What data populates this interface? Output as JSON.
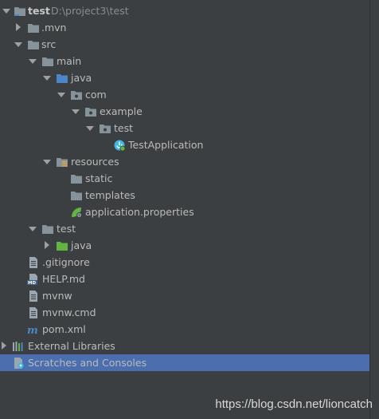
{
  "tree": {
    "rows": [
      {
        "name": "project-root-test",
        "label": "test",
        "path": "D:\\project3\\test",
        "arrow": "down",
        "icon": "project-folder-icon",
        "bold": true
      },
      {
        "name": "folder-mvn",
        "label": ".mvn",
        "arrow": "right",
        "icon": "folder-icon"
      },
      {
        "name": "folder-src",
        "label": "src",
        "arrow": "down",
        "icon": "folder-icon"
      },
      {
        "name": "folder-main",
        "label": "main",
        "arrow": "down",
        "icon": "folder-icon"
      },
      {
        "name": "folder-java",
        "label": "java",
        "arrow": "down",
        "icon": "source-root-icon"
      },
      {
        "name": "package-com",
        "label": "com",
        "arrow": "down",
        "icon": "package-icon"
      },
      {
        "name": "package-example",
        "label": "example",
        "arrow": "down",
        "icon": "package-icon"
      },
      {
        "name": "package-test",
        "label": "test",
        "arrow": "down",
        "icon": "package-icon"
      },
      {
        "name": "file-testapplication",
        "label": "TestApplication",
        "arrow": "",
        "icon": "spring-boot-class-icon"
      },
      {
        "name": "folder-resources",
        "label": "resources",
        "arrow": "down",
        "icon": "resources-folder-icon"
      },
      {
        "name": "folder-static",
        "label": "static",
        "arrow": "",
        "icon": "folder-icon"
      },
      {
        "name": "folder-templates",
        "label": "templates",
        "arrow": "",
        "icon": "folder-icon"
      },
      {
        "name": "file-application-properties",
        "label": "application.properties",
        "arrow": "",
        "icon": "spring-properties-icon"
      },
      {
        "name": "folder-test",
        "label": "test",
        "arrow": "down",
        "icon": "folder-icon"
      },
      {
        "name": "folder-test-java",
        "label": "java",
        "arrow": "right",
        "icon": "test-root-icon"
      },
      {
        "name": "file-gitignore",
        "label": ".gitignore",
        "arrow": "",
        "icon": "text-file-icon"
      },
      {
        "name": "file-help-md",
        "label": "HELP.md",
        "arrow": "",
        "icon": "markdown-file-icon"
      },
      {
        "name": "file-mvnw",
        "label": "mvnw",
        "arrow": "",
        "icon": "text-file-icon"
      },
      {
        "name": "file-mvnw-cmd",
        "label": "mvnw.cmd",
        "arrow": "",
        "icon": "text-file-icon"
      },
      {
        "name": "file-pom-xml",
        "label": "pom.xml",
        "arrow": "",
        "icon": "maven-icon"
      },
      {
        "name": "external-libraries",
        "label": "External Libraries",
        "arrow": "right",
        "icon": "libraries-icon"
      },
      {
        "name": "scratches-and-consoles",
        "label": "Scratches and Consoles",
        "arrow": "",
        "icon": "scratches-icon",
        "selected": true
      }
    ]
  },
  "watermark": "https://blog.csdn.net/lioncatch",
  "colors": {
    "background": "#3c3f41",
    "selection": "#4b6eaf",
    "text": "#bbbbbb",
    "folder": "#87939a",
    "source_root": "#4a86c8",
    "test_root": "#62b543"
  }
}
